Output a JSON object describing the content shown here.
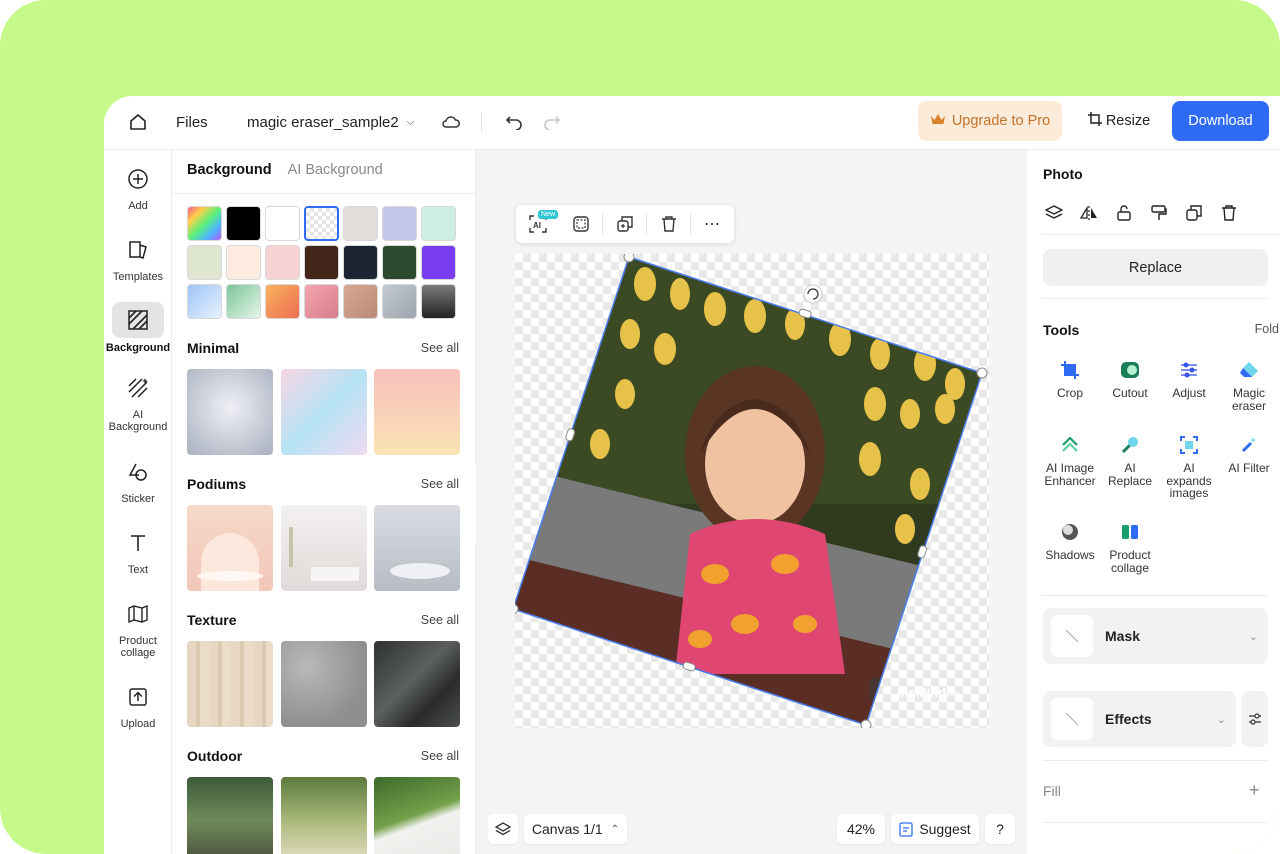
{
  "header": {
    "files_label": "Files",
    "doc_name": "magic eraser_sample2",
    "upgrade_label": "Upgrade to Pro",
    "resize_label": "Resize",
    "download_label": "Download"
  },
  "rail": {
    "items": [
      {
        "label": "Add",
        "icon": "plus-circle-icon"
      },
      {
        "label": "Templates",
        "icon": "templates-icon"
      },
      {
        "label": "Background",
        "icon": "background-icon",
        "active": true
      },
      {
        "label": "AI Background",
        "icon": "ai-background-icon"
      },
      {
        "label": "Sticker",
        "icon": "sticker-icon"
      },
      {
        "label": "Text",
        "icon": "text-icon"
      },
      {
        "label": "Product collage",
        "icon": "product-collage-icon"
      },
      {
        "label": "Upload",
        "icon": "upload-icon"
      }
    ]
  },
  "panel": {
    "tab_active": "Background",
    "tab_other": "AI Background",
    "swatches": [
      [
        "gradient-rainbow",
        "#000000",
        "#ffffff",
        "transparent",
        "#e2ddd8",
        "#c4c6ea",
        "#cdeee2"
      ],
      [
        "#dfe6d0",
        "#fdebe0",
        "#f6d3d2",
        "#432619",
        "#1d2432",
        "#2c4a2e",
        "#7a3cf0"
      ],
      [
        "gradient-sky",
        "gradient-mint",
        "gradient-orange",
        "gradient-rose",
        "gradient-tan",
        "gradient-silver",
        "gradient-charcoal"
      ]
    ],
    "sections": [
      {
        "title": "Minimal",
        "see_all": "See all"
      },
      {
        "title": "Podiums",
        "see_all": "See all"
      },
      {
        "title": "Texture",
        "see_all": "See all"
      },
      {
        "title": "Outdoor",
        "see_all": "See all"
      }
    ]
  },
  "canvas": {
    "new_badge": "New",
    "watermark": "insMind",
    "watermark_suffix": ".com",
    "canvas_label": "Canvas 1/1",
    "zoom": "42%",
    "suggest_label": "Suggest",
    "help_label": "?"
  },
  "right": {
    "title": "Photo",
    "replace_label": "Replace",
    "tools_title": "Tools",
    "fold_label": "Fold",
    "tools": [
      {
        "label": "Crop",
        "icon": "crop-icon"
      },
      {
        "label": "Cutout",
        "icon": "cutout-icon"
      },
      {
        "label": "Adjust",
        "icon": "adjust-icon"
      },
      {
        "label": "Magic eraser",
        "icon": "magic-eraser-icon"
      },
      {
        "label": "AI Image Enhancer",
        "icon": "ai-image-enhancer-icon"
      },
      {
        "label": "AI Replace",
        "icon": "ai-replace-icon"
      },
      {
        "label": "AI expands images",
        "icon": "ai-expand-icon"
      },
      {
        "label": "AI Filter",
        "icon": "ai-filter-icon"
      },
      {
        "label": "Shadows",
        "icon": "shadows-icon"
      },
      {
        "label": "Product collage",
        "icon": "product-collage-tool-icon"
      }
    ],
    "mask_label": "Mask",
    "effects_label": "Effects",
    "fill_label": "Fill"
  },
  "colors": {
    "accent": "#2f6bf6",
    "frame": "#c5f98a",
    "upgrade_bg": "#fdebd9",
    "upgrade_text": "#c4722a"
  }
}
